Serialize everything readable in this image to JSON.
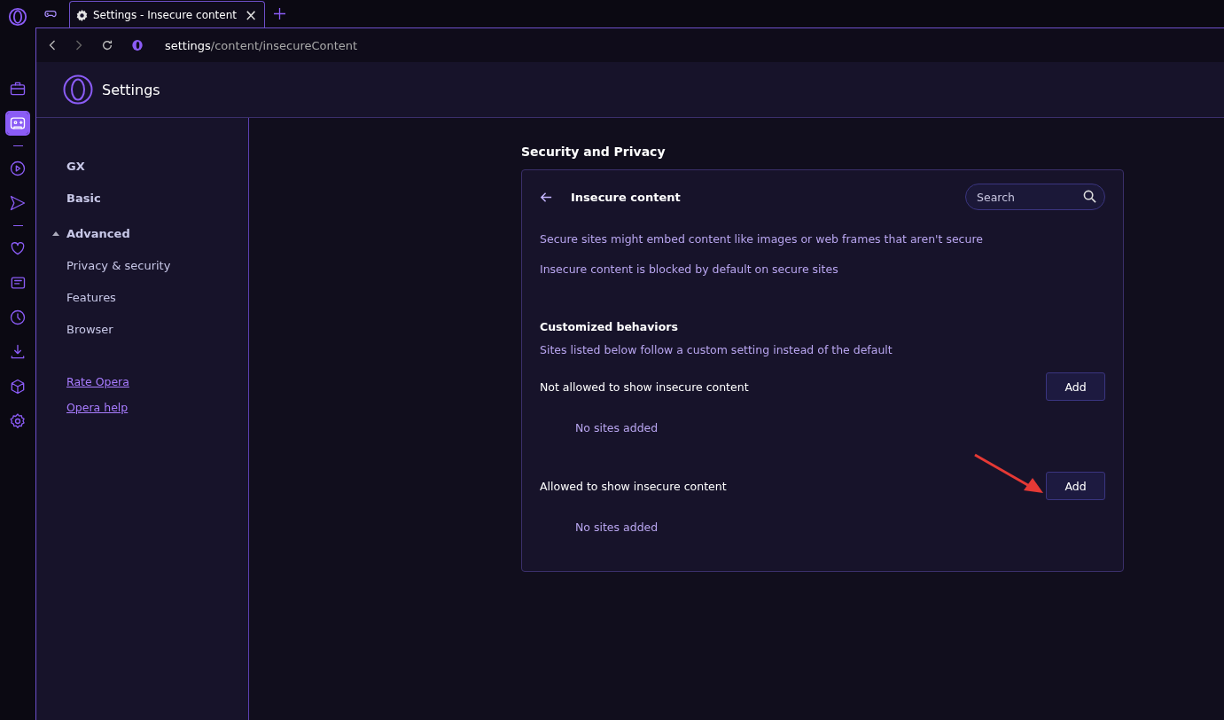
{
  "rail": [
    {
      "kind": "briefcase",
      "selected": false
    },
    {
      "kind": "gamepad",
      "selected": true
    },
    {
      "kind": "divider"
    },
    {
      "kind": "play",
      "selected": false
    },
    {
      "kind": "send",
      "selected": false
    },
    {
      "kind": "divider"
    },
    {
      "kind": "heart",
      "selected": false
    },
    {
      "kind": "news",
      "selected": false
    },
    {
      "kind": "clock",
      "selected": false
    },
    {
      "kind": "download",
      "selected": false
    },
    {
      "kind": "cube",
      "selected": false
    },
    {
      "kind": "gear",
      "selected": false
    }
  ],
  "tabs": [
    {
      "kind": "pinned",
      "selected": false
    },
    {
      "kind": "page",
      "title": "Settings - Insecure content",
      "close": "×",
      "selected": true
    }
  ],
  "address": {
    "host": "settings",
    "path": "/content/insecureContent"
  },
  "header": {
    "title": "Settings"
  },
  "nav": {
    "items": [
      {
        "label": "GX",
        "kind": "section",
        "selected": false
      },
      {
        "label": "Basic",
        "kind": "section",
        "selected": false
      },
      {
        "label": "Advanced",
        "kind": "expander",
        "expanded": true,
        "selected": false
      },
      {
        "label": "Privacy & security",
        "kind": "item",
        "selected": false
      },
      {
        "label": "Features",
        "kind": "item",
        "selected": false
      },
      {
        "label": "Browser",
        "kind": "item",
        "selected": false
      }
    ],
    "links": [
      "Rate Opera",
      "Opera help"
    ]
  },
  "main": {
    "section_title": "Security and Privacy",
    "card": {
      "title": "Insecure content",
      "search": {
        "placeholder": "Search"
      },
      "descriptions": [
        "Secure sites might embed content like images or web frames that aren't secure",
        "Insecure content is blocked by default on secure sites"
      ],
      "custom_title": "Customized behaviors",
      "custom_desc": "Sites listed below follow a custom setting instead of the default",
      "lists": [
        {
          "label": "Not allowed to show insecure content",
          "button": "Add",
          "empty": "No sites added"
        },
        {
          "label": "Allowed to show insecure content",
          "button": "Add",
          "empty": "No sites added"
        }
      ]
    }
  }
}
